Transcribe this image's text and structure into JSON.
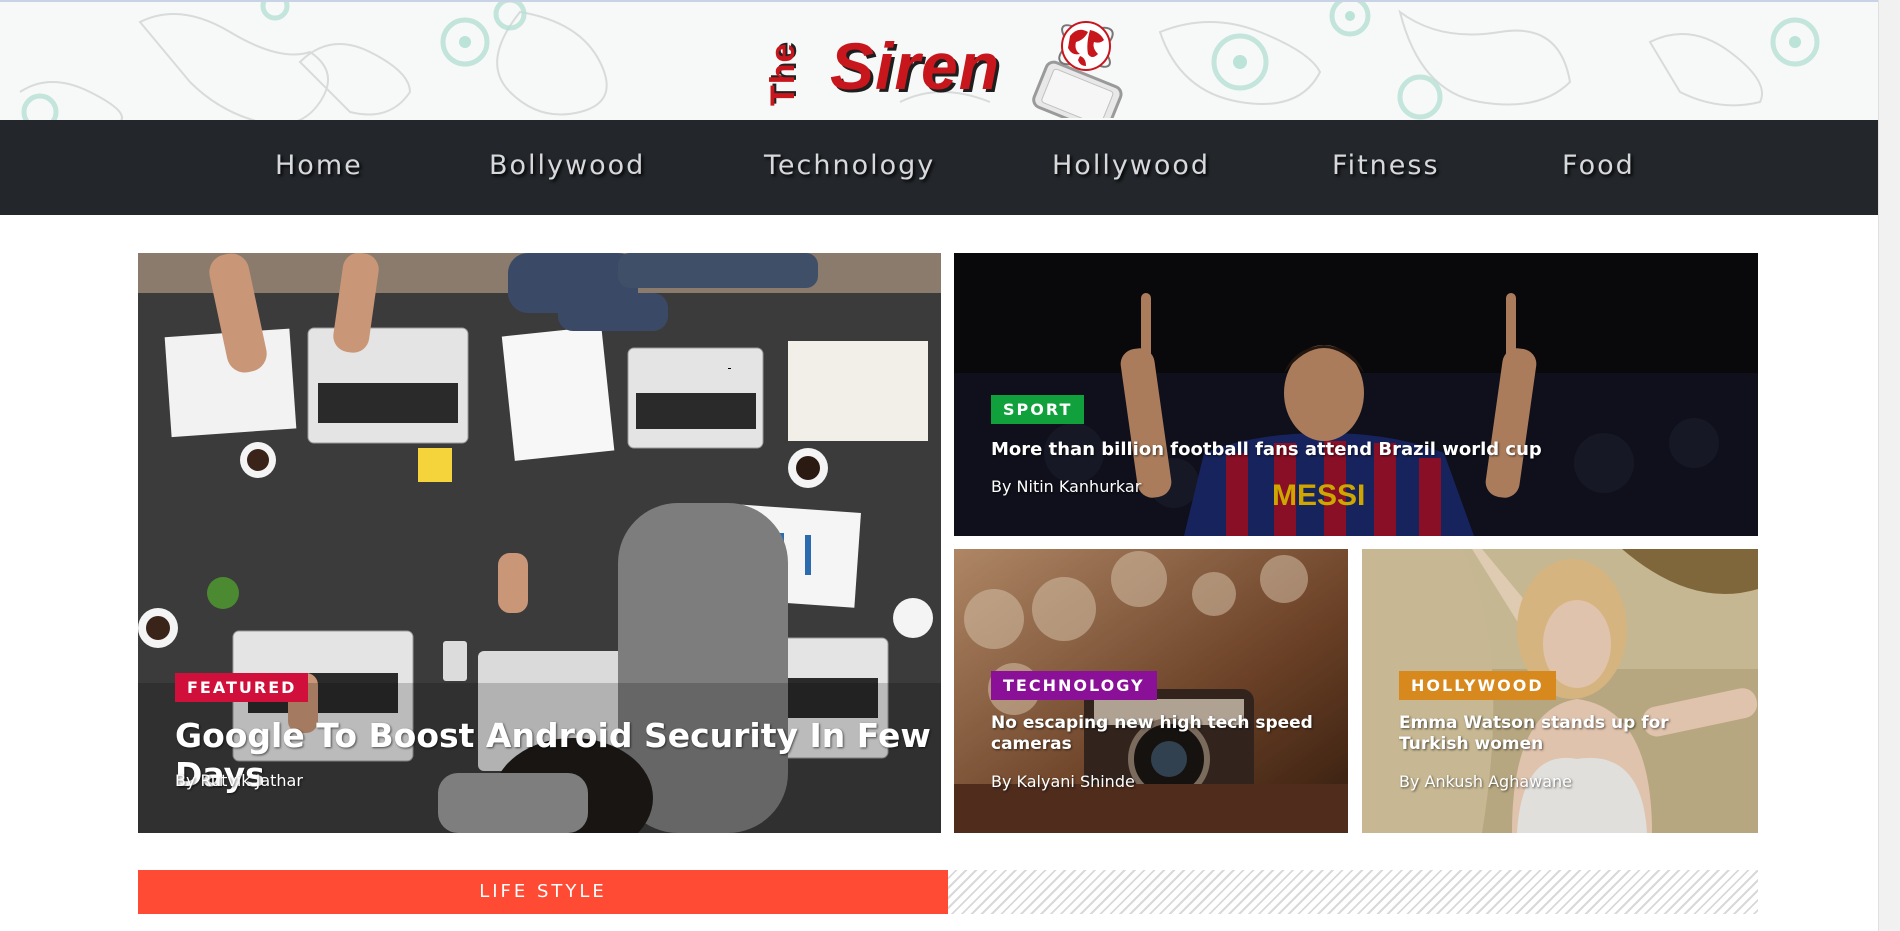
{
  "logo": {
    "the": "The",
    "siren": "Siren",
    "icon": "globe-on-phone-icon"
  },
  "nav": {
    "items": [
      {
        "label": "Home"
      },
      {
        "label": "Bollywood"
      },
      {
        "label": "Technology"
      },
      {
        "label": "Hollywood"
      },
      {
        "label": "Fitness"
      },
      {
        "label": "Food"
      }
    ]
  },
  "featured": {
    "badge": "FEATURED",
    "badge_color": "#d0103a",
    "title": "Google To Boost Android Security In Few Days",
    "author": "By Rutvik Jathar"
  },
  "sport": {
    "badge": "SPORT",
    "badge_color": "#10a03c",
    "title": "More than billion football fans attend Brazil world cup",
    "author": "By Nitin Kanhurkar",
    "jersey_text": "MESSI"
  },
  "technology": {
    "badge": "TECHNOLOGY",
    "badge_color": "#8a1097",
    "title": "No escaping new high tech speed cameras",
    "author": "By Kalyani Shinde"
  },
  "hollywood": {
    "badge": "HOLLYWOOD",
    "badge_color": "#d8891e",
    "title": "Emma Watson stands up for Turkish women",
    "author": "By Ankush Aghawane"
  },
  "section": {
    "label": "LIFE STYLE",
    "color": "#ff4a34"
  }
}
